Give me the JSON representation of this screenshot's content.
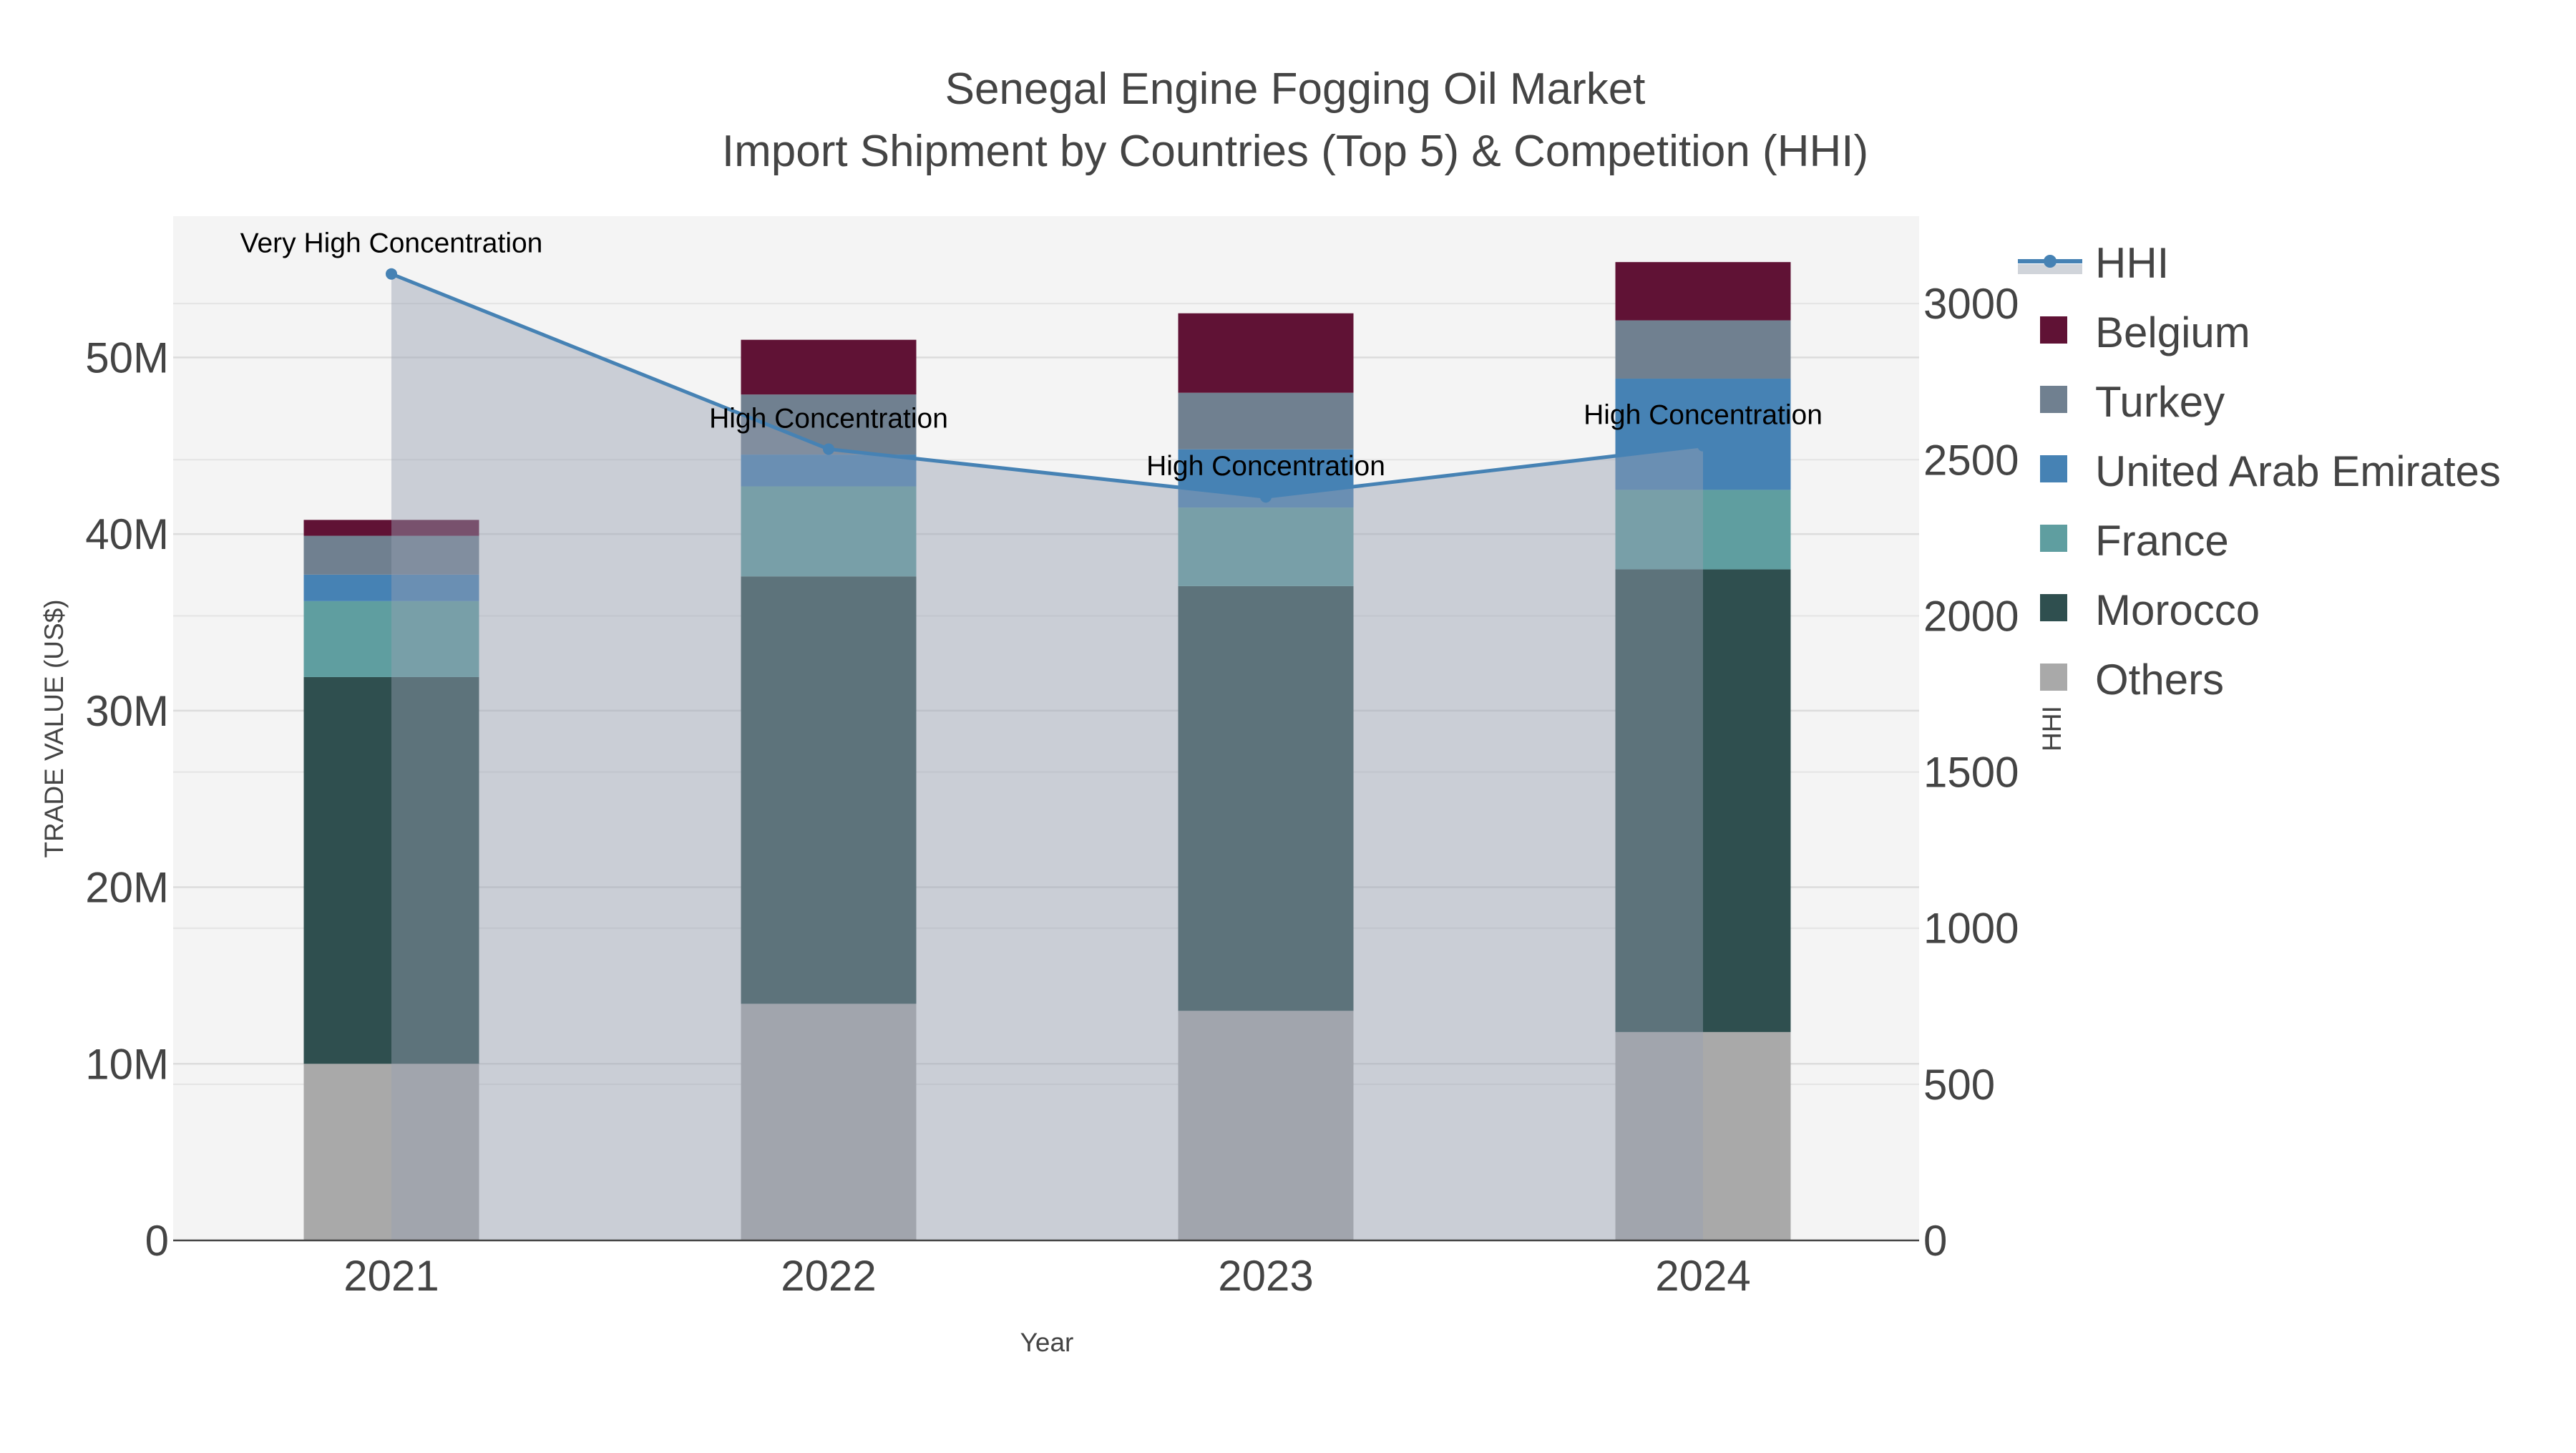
{
  "chart_data": {
    "type": "bar",
    "title": "Senegal Engine Fogging Oil Market",
    "subtitle": "Import Shipment by Countries (Top 5) & Competition (HHI)",
    "xlabel": "Year",
    "ylabel": "TRADE VALUE (US$)",
    "y2label": "HHI",
    "categories": [
      "2021",
      "2022",
      "2023",
      "2024"
    ],
    "stacked": true,
    "ylim": [
      0,
      58000000
    ],
    "y2lim": [
      0,
      3280
    ],
    "yticks": [
      {
        "v": 0,
        "label": "0"
      },
      {
        "v": 10000000,
        "label": "10M"
      },
      {
        "v": 20000000,
        "label": "20M"
      },
      {
        "v": 30000000,
        "label": "30M"
      },
      {
        "v": 40000000,
        "label": "40M"
      },
      {
        "v": 50000000,
        "label": "50M"
      }
    ],
    "y2ticks": [
      {
        "v": 0,
        "label": "0"
      },
      {
        "v": 500,
        "label": "500"
      },
      {
        "v": 1000,
        "label": "1000"
      },
      {
        "v": 1500,
        "label": "1500"
      },
      {
        "v": 2000,
        "label": "2000"
      },
      {
        "v": 2500,
        "label": "2500"
      },
      {
        "v": 3000,
        "label": "3000"
      }
    ],
    "series": [
      {
        "name": "Others",
        "color": "#a9a9a9",
        "values": [
          10000000,
          13400000,
          13000000,
          11800000
        ]
      },
      {
        "name": "Morocco",
        "color": "#2f4f4f",
        "values": [
          21900000,
          24200000,
          24050000,
          26200000
        ]
      },
      {
        "name": "France",
        "color": "#5f9ea0",
        "values": [
          4300000,
          5100000,
          4450000,
          4500000
        ]
      },
      {
        "name": "United Arab Emirates",
        "color": "#4682b4",
        "values": [
          1500000,
          1800000,
          3300000,
          6300000
        ]
      },
      {
        "name": "Turkey",
        "color": "#708090",
        "values": [
          2200000,
          3400000,
          3200000,
          3300000
        ]
      },
      {
        "name": "Belgium",
        "color": "#601235",
        "values": [
          900000,
          3100000,
          4500000,
          3300000
        ]
      }
    ],
    "hhi": {
      "name": "HHI",
      "color": "#4682b4",
      "values": [
        3095,
        2534,
        2381,
        2545
      ],
      "annotations": [
        "Very High Concentration",
        "High Concentration",
        "High Concentration",
        "High Concentration"
      ]
    },
    "legend_order": [
      "HHI",
      "Belgium",
      "Turkey",
      "United Arab Emirates",
      "France",
      "Morocco",
      "Others"
    ],
    "legend_placement": "right",
    "grid": true
  }
}
